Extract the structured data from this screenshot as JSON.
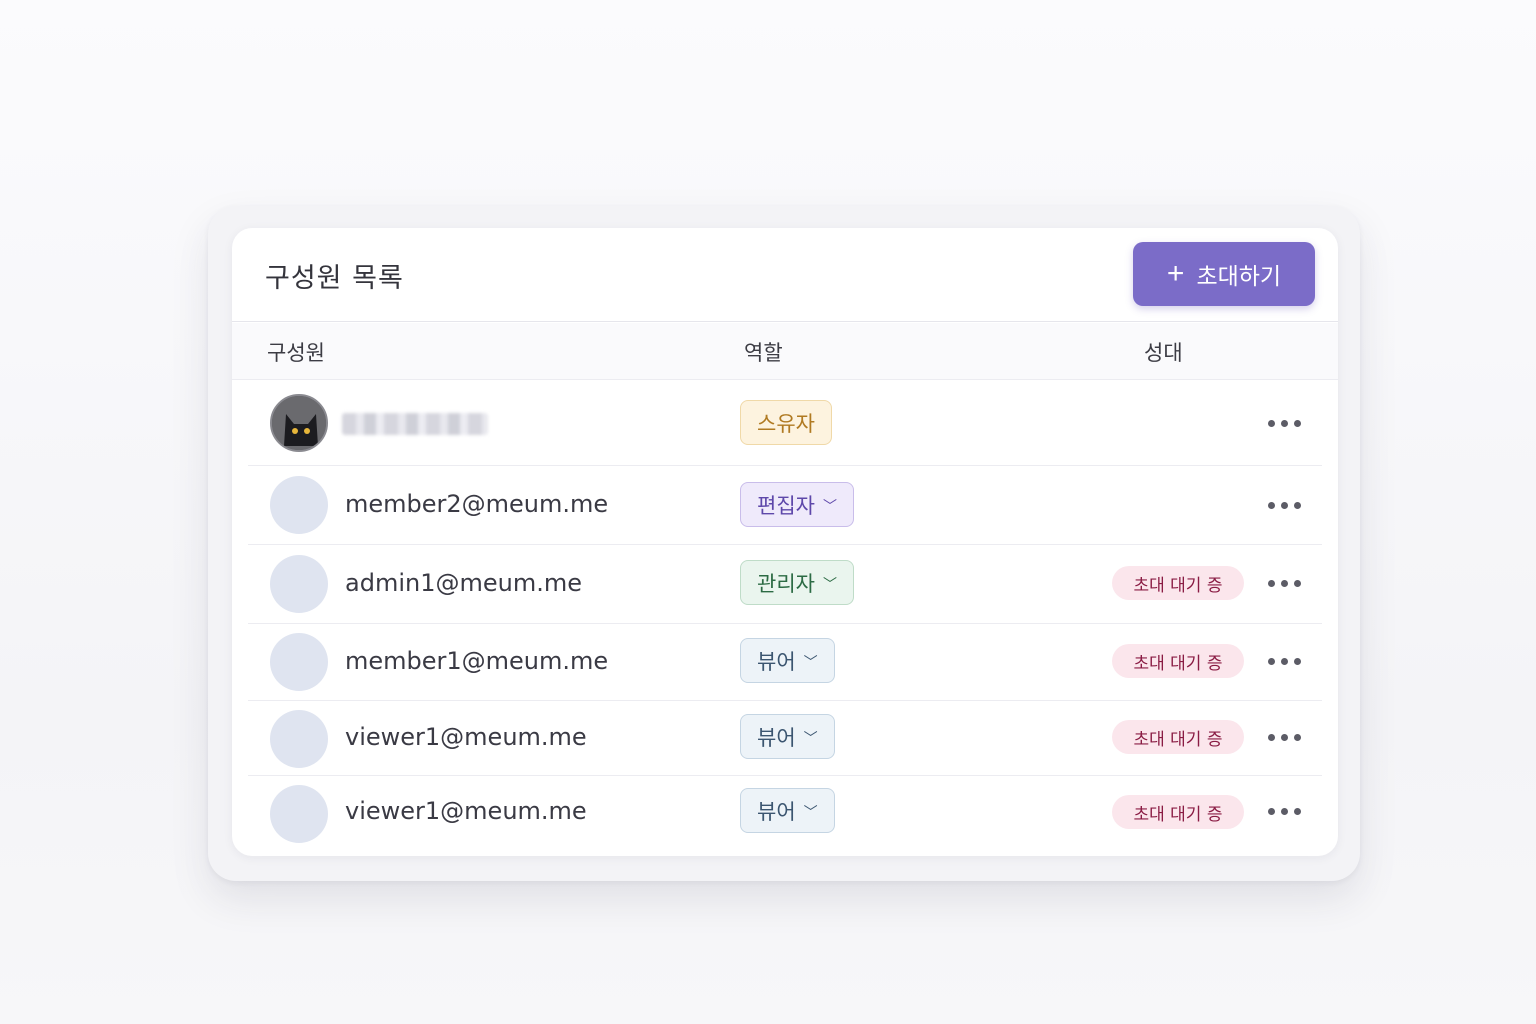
{
  "header": {
    "title": "구성원 목록",
    "invite_label": "초대하기"
  },
  "columns": {
    "member": "구성원",
    "role": "역할",
    "invite": "성대"
  },
  "rows": [
    {
      "email": "",
      "redacted": true,
      "role": "스유자",
      "role_type": "owner",
      "dropdown": false,
      "pending": ""
    },
    {
      "email": "member2@meum.me",
      "role": "편집자",
      "role_type": "editor",
      "dropdown": true,
      "pending": ""
    },
    {
      "email": "admin1@meum.me",
      "role": "관리자",
      "role_type": "admin",
      "dropdown": true,
      "pending": "초대 대기 증"
    },
    {
      "email": "member1@meum.me",
      "role": "뷰어",
      "role_type": "viewer",
      "dropdown": true,
      "pending": "초대 대기 증"
    },
    {
      "email": "viewer1@meum.me",
      "role": "뷰어",
      "role_type": "viewer",
      "dropdown": true,
      "pending": "초대 대기 증"
    },
    {
      "email": "viewer1@meum.me",
      "role": "뷰어",
      "role_type": "viewer",
      "dropdown": true,
      "pending": "초대 대기 증"
    }
  ],
  "colors": {
    "accent": "#7b6cc8",
    "owner": "#b07a22",
    "editor": "#5e48aa",
    "admin": "#2c6b44",
    "viewer": "#3b5570",
    "pending": "#8a1c44"
  }
}
